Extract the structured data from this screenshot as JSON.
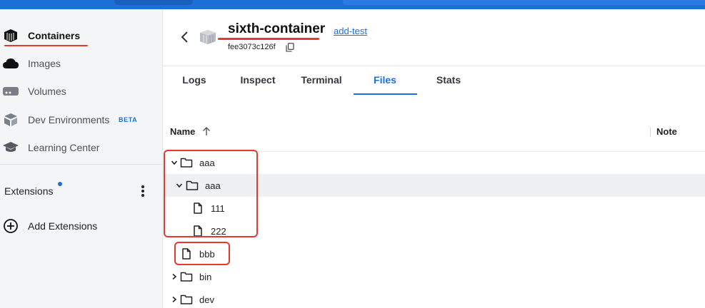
{
  "sidebar": {
    "items": [
      {
        "label": "Containers",
        "icon": "container-icon",
        "active": true
      },
      {
        "label": "Images",
        "icon": "cloud-icon",
        "active": false
      },
      {
        "label": "Volumes",
        "icon": "volume-icon",
        "active": false
      },
      {
        "label": "Dev Environments",
        "icon": "dev-env-icon",
        "active": false,
        "badge": "BETA"
      },
      {
        "label": "Learning Center",
        "icon": "graduation-cap-icon",
        "active": false
      }
    ],
    "extensions_label": "Extensions",
    "add_extensions_label": "Add Extensions"
  },
  "header": {
    "container_name": "sixth-container",
    "image_link": "add-test",
    "container_id": "fee3073c126f"
  },
  "tabs": [
    "Logs",
    "Inspect",
    "Terminal",
    "Files",
    "Stats"
  ],
  "active_tab": "Files",
  "table": {
    "name_header": "Name",
    "note_header": "Note",
    "rows": [
      {
        "name": "aaa",
        "type": "folder",
        "expanded": true
      },
      {
        "name": "aaa",
        "type": "folder",
        "expanded": true
      },
      {
        "name": "111",
        "type": "file"
      },
      {
        "name": "222",
        "type": "file"
      },
      {
        "name": "bbb",
        "type": "file"
      },
      {
        "name": "bin",
        "type": "folder",
        "expanded": false
      },
      {
        "name": "dev",
        "type": "folder",
        "expanded": false
      }
    ]
  },
  "colors": {
    "accent": "#1d6fd8",
    "annotation_red": "#e23a2e",
    "sidebar_bg": "#f4f5f6"
  }
}
